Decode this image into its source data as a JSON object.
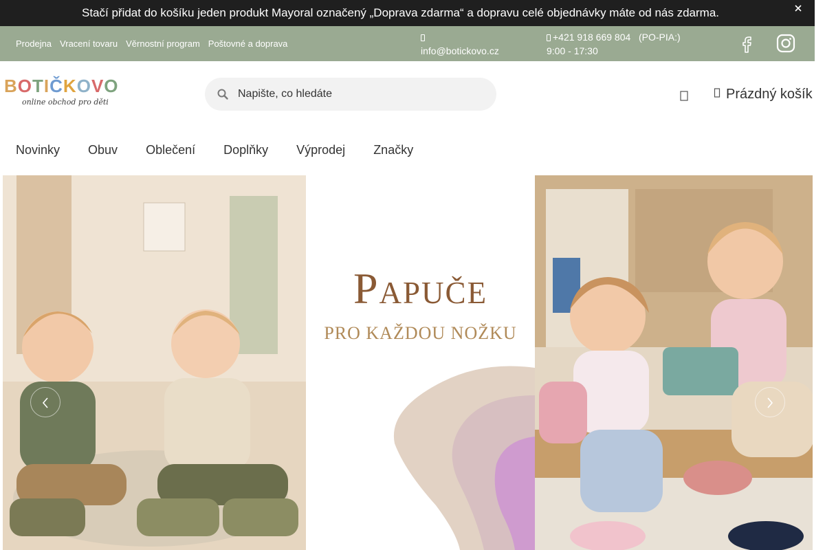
{
  "announcement": {
    "text": "Stačí přidat do košíku jeden produkt Mayoral označený „Doprava zdarma“ a dopravu celé objednávky máte od nás zdarma."
  },
  "topbar": {
    "links": [
      "Prodejna",
      "Vracení tovaru",
      "Věrnostní program",
      "Poštovné a doprava"
    ],
    "email": "info@botickovo.cz",
    "phone": "+421 918 669 804",
    "hours_days": "(PO-PIA:)",
    "hours_time": "9:00 - 17:30"
  },
  "header": {
    "logo_text": "BOTIČKOVO",
    "logo_tagline": "online obchod pro děti",
    "search_placeholder": "Napište, co hledáte",
    "cart_label": "Prázdný košík"
  },
  "nav": {
    "items": [
      "Novinky",
      "Obuv",
      "Oblečení",
      "Doplňky",
      "Výprodej",
      "Značky"
    ]
  },
  "hero": {
    "title": "Papuče",
    "subtitle": "PRO KAŽDOU NOŽKU"
  },
  "icons": {
    "close": "close-icon",
    "email": "email-icon",
    "phone": "phone-icon",
    "facebook": "facebook-icon",
    "instagram": "instagram-icon",
    "search": "search-icon",
    "account": "user-icon",
    "cart": "cart-icon",
    "prev": "chevron-left-icon",
    "next": "chevron-right-icon"
  },
  "colors": {
    "announcement_bg": "#1f1f1f",
    "topbar_bg": "#9aaa92",
    "hero_title": "#8a5a35",
    "hero_subtitle": "#b08a58",
    "logo_letters": [
      "#d9a35a",
      "#d86a6a",
      "#7ea37e",
      "#d9a35a",
      "#6f9bd1",
      "#e0a43f",
      "#8fb2c9",
      "#d86a6a",
      "#7ea37e"
    ]
  }
}
